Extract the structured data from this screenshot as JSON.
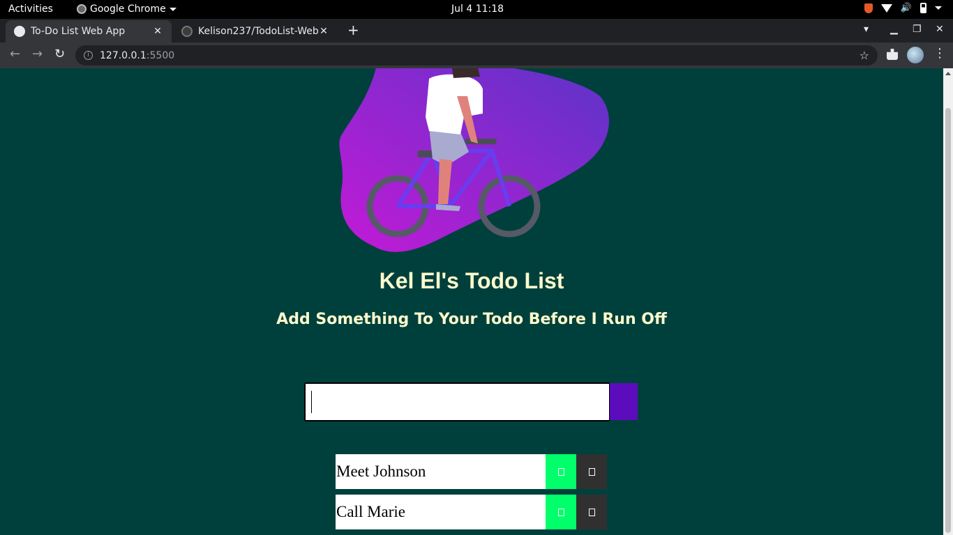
{
  "system_bar": {
    "activities": "Activities",
    "app_name": "Google Chrome",
    "clock": "Jul 4  11:18"
  },
  "browser": {
    "tabs": [
      {
        "title": "To-Do List Web App",
        "active": true
      },
      {
        "title": "Kelison237/TodoList-Web",
        "active": false
      }
    ],
    "url_host": "127.0.0.1",
    "url_port": ":5500"
  },
  "page": {
    "background_color": "#00403c",
    "title": "Kel El's Todo List",
    "subtitle": "Add Something To Your Todo Before I Run Off",
    "input": {
      "value": "",
      "placeholder": ""
    },
    "add_button_color": "#5d0cbd",
    "todos": [
      {
        "text": "Meet Johnson"
      },
      {
        "text": "Call Marie"
      }
    ],
    "complete_button_color": "#00ff6a",
    "trash_button_color": "#303030",
    "text_color": "#fffacd"
  }
}
